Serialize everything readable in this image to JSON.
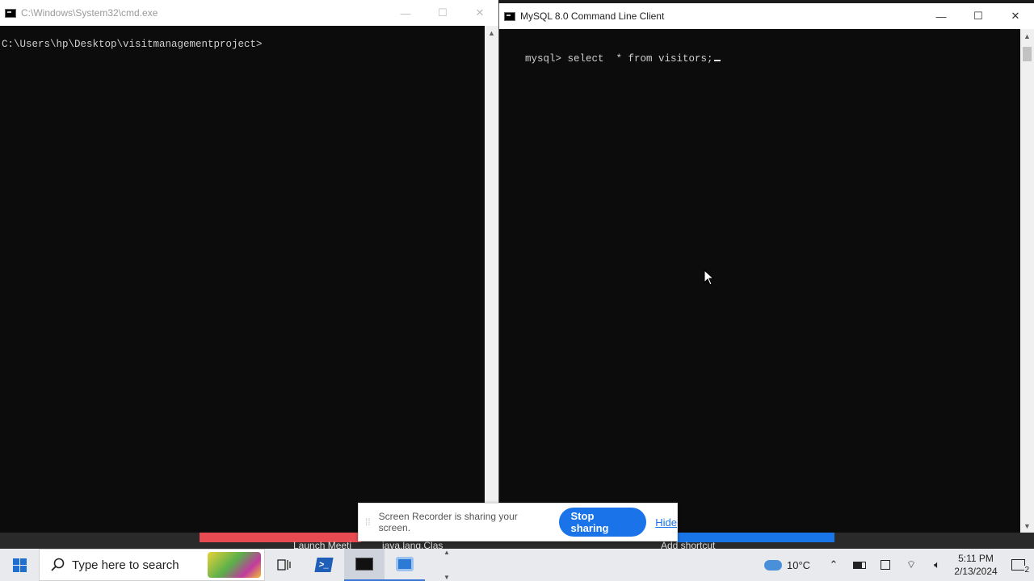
{
  "left_window": {
    "title": "C:\\Windows\\System32\\cmd.exe",
    "prompt": "C:\\Users\\hp\\Desktop\\visitmanagementproject>"
  },
  "right_window": {
    "title": "MySQL 8.0 Command Line Client",
    "command_line": "mysql> select  * from visitors;"
  },
  "screen_share": {
    "message": "Screen Recorder is sharing your screen.",
    "stop_label": "Stop sharing",
    "hide_label": "Hide"
  },
  "bookmarks": [
    "Launch Meeti",
    "java.lang.Clas",
    "Add shortcut"
  ],
  "taskbar": {
    "search_placeholder": "Type here to search",
    "weather": "10°C",
    "time": "5:11 PM",
    "date": "2/13/2024",
    "notification_count": "2"
  },
  "colors": {
    "console_bg": "#0c0c0c",
    "console_text": "#cfcfcf",
    "accent_blue": "#1a73e8",
    "red_strip": "#e84a52",
    "blue_strip": "#1976e8"
  }
}
